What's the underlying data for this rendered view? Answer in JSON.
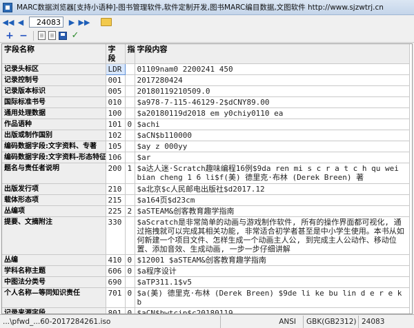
{
  "window": {
    "title": "MARC数据浏览器[支持小语种]-图书管理软件,软件定制开发,图书MARC编目数据,文图软件 http://www.sjzwtrj.cn"
  },
  "navbar": {
    "record_number": "24083",
    "icons": [
      "first-icon",
      "prev-icon",
      "next-icon",
      "last-icon",
      "open-folder-icon"
    ]
  },
  "toolbar": {
    "add_label": "+",
    "remove_label": "−",
    "check_label": "✓",
    "icons": [
      "add-icon",
      "remove-icon",
      "copy-icon",
      "paste-icon",
      "save-icon",
      "check-icon"
    ]
  },
  "grid": {
    "headers": {
      "name": "字段名称",
      "tag": "字段",
      "ind": "指",
      "content": "字段内容"
    },
    "rows": [
      {
        "name": "记录头标区",
        "tag": "LDR",
        "ind": "",
        "content": "01109nam0 2200241   450"
      },
      {
        "name": "记录控制号",
        "tag": "001",
        "ind": "",
        "content": "2017280424"
      },
      {
        "name": "记录版本标识",
        "tag": "005",
        "ind": "",
        "content": "20180119210509.0"
      },
      {
        "name": "国际标准书号",
        "tag": "010",
        "ind": "",
        "content": "$a978-7-115-46129-2$dCNY89.00"
      },
      {
        "name": "通用处理数据",
        "tag": "100",
        "ind": "",
        "content": "$a20180119d2018    em y0chiy0110    ea"
      },
      {
        "name": "作品语种",
        "tag": "101",
        "ind": "0",
        "content": "$achi"
      },
      {
        "name": "出版或制作国别",
        "tag": "102",
        "ind": "",
        "content": "$aCN$b110000"
      },
      {
        "name": "编码数据字段:文字资料、专著",
        "tag": "105",
        "ind": "",
        "content": "$ay   z    000yy"
      },
      {
        "name": "编码数据字段:文字资料-形态特征",
        "tag": "106",
        "ind": "",
        "content": "$ar"
      },
      {
        "name": "题名与责任者说明",
        "tag": "200",
        "ind": "1",
        "content": "$a达人迷·Scratch趣味编程16例$9da ren mi  s c r a t c h qu wei bian cheng 1 6 li$f(美) 德里克·布林 (Derek Breen) 著"
      },
      {
        "name": "出版发行项",
        "tag": "210",
        "ind": "",
        "content": "$a北京$c人民邮电出版社$d2017.12"
      },
      {
        "name": "载体形态项",
        "tag": "215",
        "ind": "",
        "content": "$a164页$d23cm"
      },
      {
        "name": "丛编项",
        "tag": "225",
        "ind": "2",
        "content": "$aSTEAM&创客教育趣学指南"
      },
      {
        "name": "提要、文摘附注",
        "tag": "330",
        "ind": "",
        "content": "$aScratch是非常简单的动画与游戏制作软件, 所有的操作界面都可视化, 通过拖拽就可以完成其相关功能, 非常适合初学者甚至是中小学生使用。本书从如何新建一个项目文件、怎样生成一个动画主人公, 到完成主人公动作、移动位置、添加音效、生成动画, 一步一步仔细讲解"
      },
      {
        "name": "丛编",
        "tag": "410",
        "ind": "0",
        "content": "$12001 $aSTEAM&创客教育趣学指南"
      },
      {
        "name": "学科名称主题",
        "tag": "606",
        "ind": "0",
        "content": "$a程序设计"
      },
      {
        "name": "中图法分类号",
        "tag": "690",
        "ind": "",
        "content": "$aTP311.1$v5"
      },
      {
        "name": "个人名称—等同知识责任",
        "tag": "701",
        "ind": "0",
        "content": "$a(美) 德里克·布林 (Derek Breen) $9de li ke bu lin  d e r e k b"
      },
      {
        "name": "记录来源字段",
        "tag": "801",
        "ind": "0",
        "content": "$aCN$bwtcip$c20180119"
      }
    ]
  },
  "statusbar": {
    "file": "...\\pfwd_...60-2017284261.iso",
    "encoding": "ANSI",
    "charset": "GBK(GB2312)",
    "record_count": "24083"
  }
}
